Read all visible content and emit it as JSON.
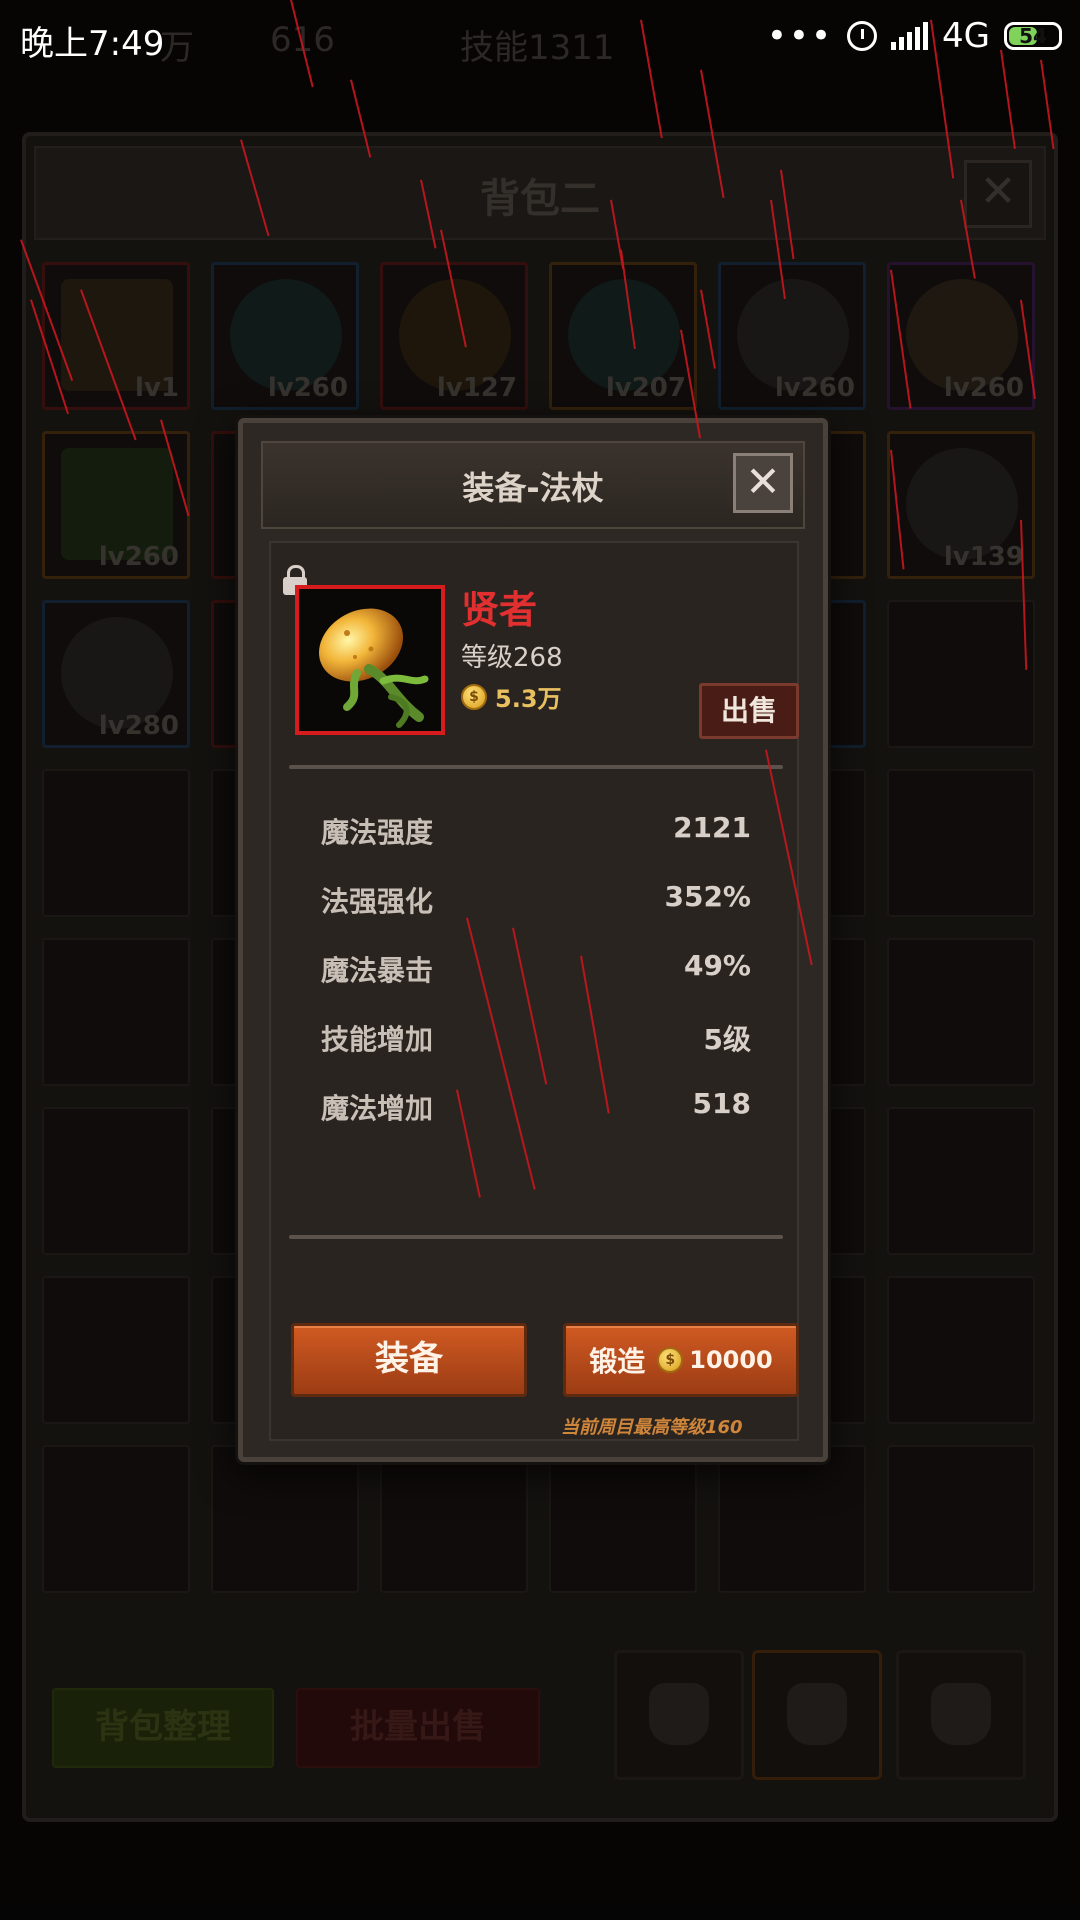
{
  "status_bar": {
    "time": "晚上7:49",
    "dots": "•••",
    "network": "4G",
    "battery": "54"
  },
  "background": {
    "hud": [
      "万",
      "616",
      "技能1311"
    ],
    "bag_title": "背包二",
    "close_symbol": "✕",
    "slots_row1": [
      {
        "level": "lv1",
        "quality": "red"
      },
      {
        "level": "lv260",
        "quality": "blue"
      },
      {
        "level": "lv127",
        "quality": "red"
      },
      {
        "level": "lv207",
        "quality": "orange"
      },
      {
        "level": "lv260",
        "quality": "blue"
      },
      {
        "level": "lv260",
        "quality": "purple"
      }
    ],
    "slots_row2": [
      {
        "level": "lv260",
        "quality": "orange"
      },
      {
        "level": "lv139",
        "quality": "orange"
      }
    ],
    "slots_row3": [
      {
        "level": "lv280",
        "quality": "blue"
      }
    ],
    "sort_button": "背包整理",
    "bulk_sell_button": "批量出售"
  },
  "modal": {
    "title": "装备-法杖",
    "close_symbol": "✕",
    "item": {
      "name": "贤者",
      "level_text": "等级268",
      "price": "5.3万",
      "coin_symbol": "$",
      "name_color": "#e23030",
      "frame_color": "#d61c1c"
    },
    "sell_button": "出售",
    "stats": [
      {
        "label": "魔法强度",
        "value": "2121"
      },
      {
        "label": "法强强化",
        "value": "352%"
      },
      {
        "label": "魔法暴击",
        "value": "49%"
      },
      {
        "label": "技能增加",
        "value": "5级"
      },
      {
        "label": "魔法增加",
        "value": "518"
      }
    ],
    "equip_button": "装备",
    "forge_button": "锻造",
    "forge_cost": "10000",
    "forge_note": "当前周目最高等级160"
  },
  "colors": {
    "accent_orange": "#d05a22",
    "rain": "#c8161e",
    "gold": "#e8c060"
  }
}
